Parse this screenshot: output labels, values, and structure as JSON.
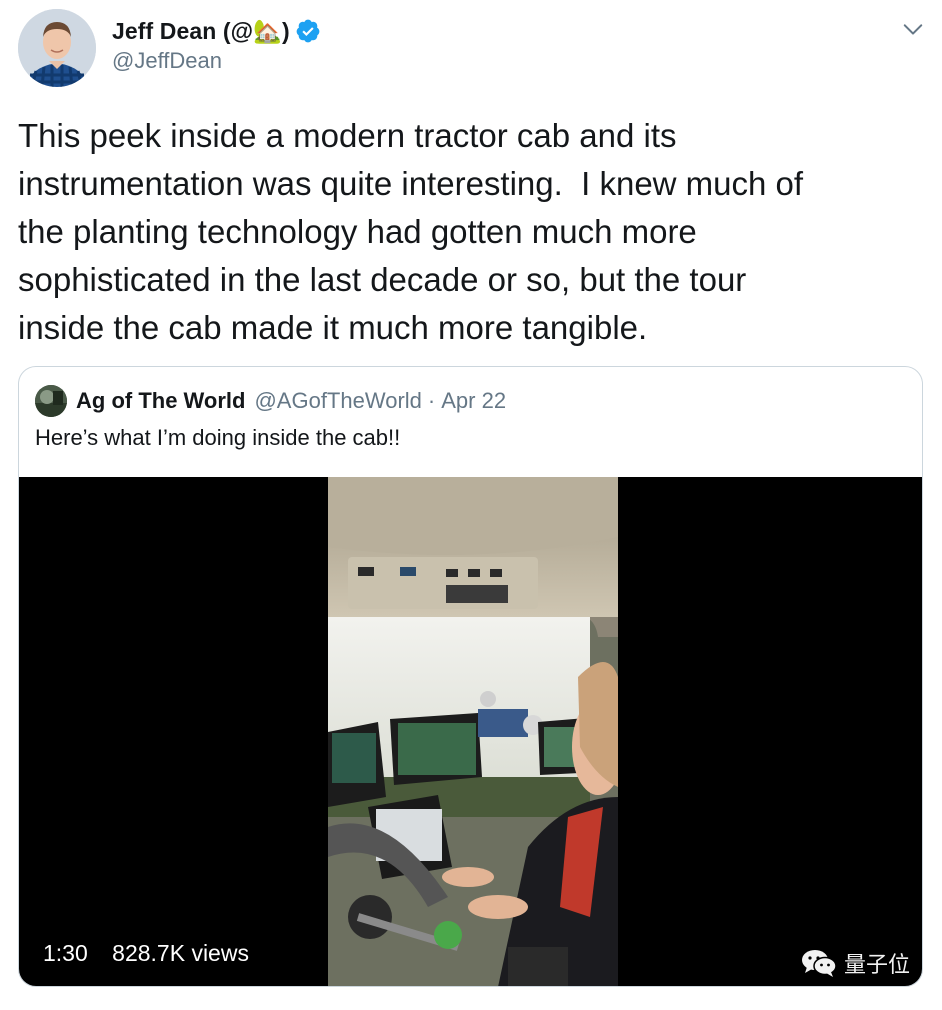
{
  "tweet": {
    "author": {
      "display_name": "Jeff Dean (@🏡)",
      "handle": "@JeffDean",
      "verified": true,
      "avatar_icon": "profile-photo"
    },
    "menu_icon": "chevron-down-icon",
    "text": "This peek inside a modern tractor cab and its\ninstrumentation was quite interesting.  I knew much of\nthe planting technology had gotten much more\nsophisticated in the last decade or so, but the tour\ninside the cab made it much more tangible."
  },
  "quoted_tweet": {
    "author": {
      "display_name": "Ag of The World",
      "handle": "@AGofTheWorld",
      "separator": "·",
      "date": "Apr 22",
      "avatar_icon": "profile-photo"
    },
    "text": "Here’s what I’m doing inside the cab!!",
    "video": {
      "duration": "1:30",
      "views": "828.7K views"
    }
  },
  "watermark": {
    "text": "量子位",
    "icon": "wechat-icon"
  },
  "colors": {
    "text_primary": "#14171a",
    "text_secondary": "#657786",
    "verified_blue": "#1da1f2",
    "border": "#ccd6dd",
    "video_bg": "#000000"
  }
}
